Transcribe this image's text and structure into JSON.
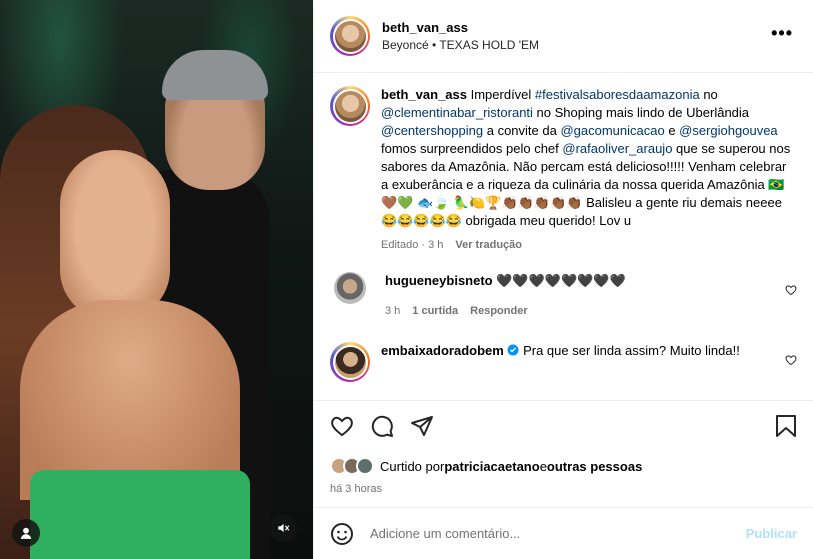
{
  "post": {
    "username": "beth_van_ass",
    "song": "Beyoncé • TEXAS HOLD 'EM",
    "more_label": "•••"
  },
  "caption": {
    "username": "beth_van_ass",
    "t1": " Imperdível ",
    "tag1": "#festivalsaboresdaamazonia",
    "t2": " no ",
    "m1": "@clementinabar_ristoranti",
    "t3": " no Shoping mais lindo de Uberlândia ",
    "m2": "@centershopping",
    "t4": " a convite da ",
    "m3": "@gacomunicacao",
    "t5": " e ",
    "m4": "@sergiohgouvea",
    "t6": " fomos surpreendidos pelo chef ",
    "m5": "@rafaoliver_araujo",
    "t7": " que se superou nos sabores da Amazônia. Não percam está delicioso!!!!! Venham celebrar a exuberância e a riqueza da culinária da nossa querida Amazônia 🇧🇷🤎💚 🐟🍃 🦜🍋🏆👏🏾👏🏾👏🏾👏🏾👏🏾 Balisleu a gente riu demais neeee 😂😂😂😂😂 obrigada meu querido! Lov u",
    "edited": "Editado · 3 h",
    "translate": "Ver tradução"
  },
  "comments": [
    {
      "username": "hugueneybisneto",
      "text": " 🖤🖤🖤🖤🖤🖤🖤🖤",
      "time": "3 h",
      "likes": "1 curtida",
      "reply": "Responder"
    },
    {
      "username": "embaixadoradobem",
      "text": " Pra que ser linda assim? Muito linda!!"
    }
  ],
  "likes": {
    "prefix": "Curtido por ",
    "user": "patriciacaetano",
    "mid": " e ",
    "others": "outras pessoas"
  },
  "time_ago": "há 3 horas",
  "add_comment": {
    "placeholder": "Adicione um comentário...",
    "post_label": "Publicar"
  },
  "colors": {
    "link": "#00376b",
    "muted": "#737373",
    "post_button": "#b2dffc",
    "verified": "#0095f6"
  }
}
